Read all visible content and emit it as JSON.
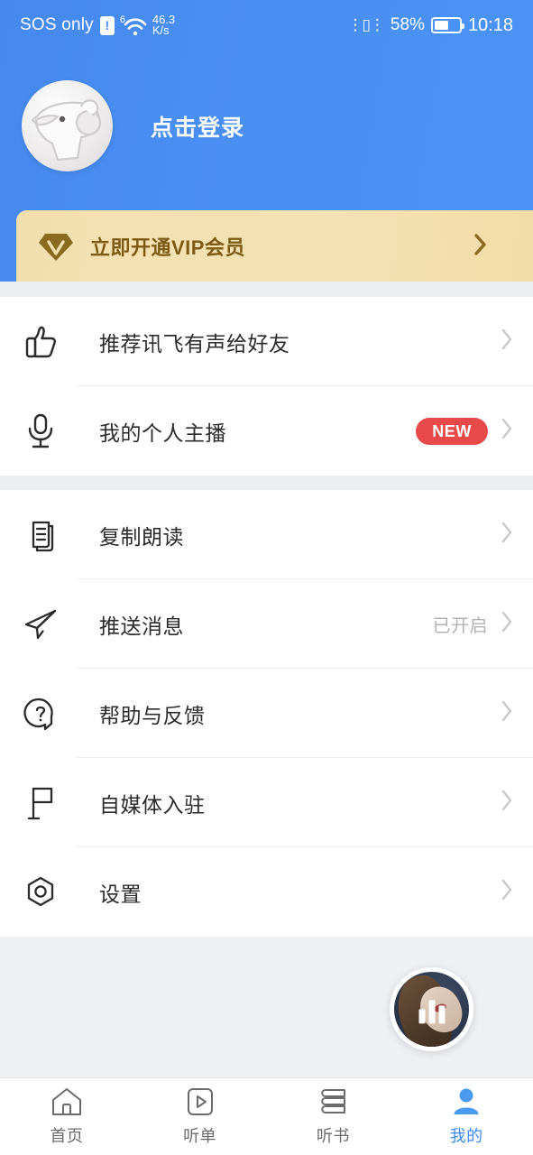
{
  "status_bar": {
    "carrier": "SOS only",
    "alert_glyph": "!",
    "wifi_gen": "6",
    "net_speed_value": "46.3",
    "net_speed_unit": "K/s",
    "battery_percent": "58%",
    "battery_level": 58,
    "clock": "10:18"
  },
  "header": {
    "login_label": "点击登录",
    "avatar_name": "default-bird-avatar",
    "background_color": "#4589ef"
  },
  "vip_banner": {
    "label": "立即开通VIP会员",
    "icon": "vip-diamond-icon",
    "background_color": "#f3dfae",
    "text_color": "#7d5a16"
  },
  "sections": [
    {
      "id": "promote",
      "rows": [
        {
          "icon": "thumbs-up-icon",
          "label": "推荐讯飞有声给好友",
          "value": "",
          "badge": ""
        },
        {
          "icon": "microphone-icon",
          "label": "我的个人主播",
          "value": "",
          "badge": "NEW"
        }
      ]
    },
    {
      "id": "tools",
      "rows": [
        {
          "icon": "copy-read-icon",
          "label": "复制朗读",
          "value": "",
          "badge": ""
        },
        {
          "icon": "paper-plane-icon",
          "label": "推送消息",
          "value": "已开启",
          "badge": ""
        },
        {
          "icon": "question-circle-icon",
          "label": "帮助与反馈",
          "value": "",
          "badge": ""
        },
        {
          "icon": "flag-icon",
          "label": "自媒体入驻",
          "value": "",
          "badge": ""
        },
        {
          "icon": "settings-hexagon-icon",
          "label": "设置",
          "value": "",
          "badge": ""
        }
      ]
    }
  ],
  "mini_player": {
    "name": "floating-mini-player",
    "state_icon": "playing-bars-icon"
  },
  "tabbar": {
    "items": [
      {
        "icon": "home-icon",
        "label": "首页",
        "active": false
      },
      {
        "icon": "playlist-icon",
        "label": "听单",
        "active": false
      },
      {
        "icon": "book-icon",
        "label": "听书",
        "active": false
      },
      {
        "icon": "person-icon",
        "label": "我的",
        "active": true
      }
    ],
    "active_color": "#3d8bf2",
    "inactive_color": "#6b6b6b"
  },
  "badge_colors": {
    "new_badge": "#e84a4a"
  }
}
